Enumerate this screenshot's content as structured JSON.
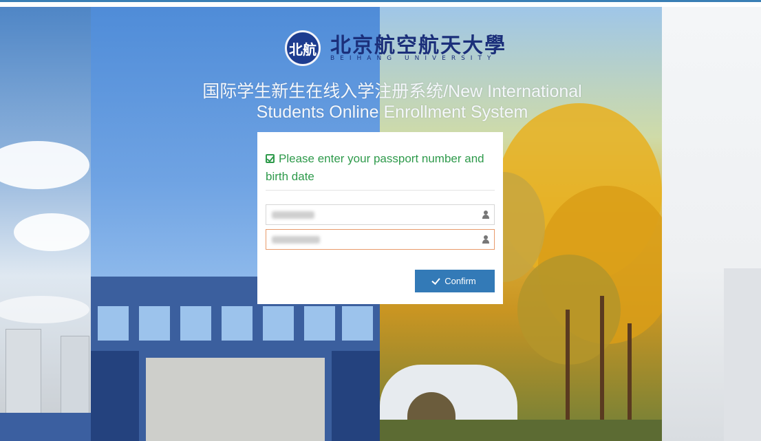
{
  "university": {
    "name_cn": "北京航空航天大學",
    "name_en": "BEIHANG UNIVERSITY",
    "seal_glyph": "北航"
  },
  "page": {
    "title_line1": "国际学生新生在线入学注册系统/New International",
    "title_line2": "Students Online Enrollment System"
  },
  "form": {
    "prompt": "Please enter your passport number and birth date",
    "passport_value": "",
    "birthdate_value": "",
    "confirm_label": "Confirm"
  },
  "colors": {
    "accent": "#337ab7",
    "prompt_green": "#2e9a4b",
    "top_border": "#3a7fb5"
  }
}
